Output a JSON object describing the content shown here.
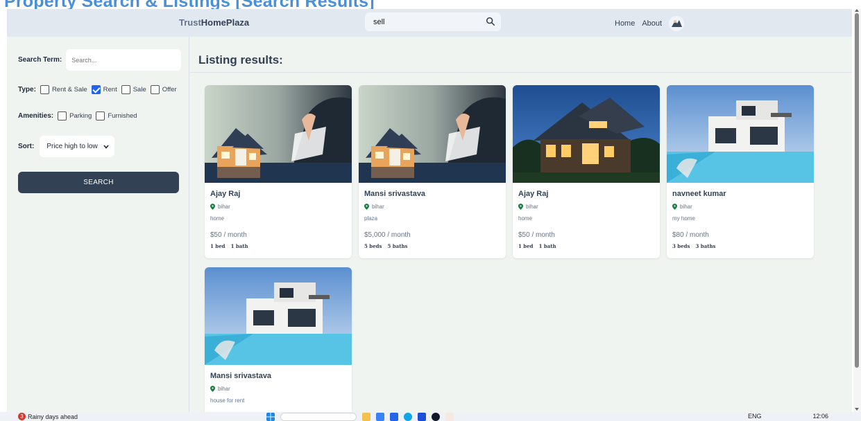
{
  "caption": "Property Search & Listings [Search Results]",
  "header": {
    "logo_light": "Trust",
    "logo_bold": "HomePlaza",
    "search_value": "sell",
    "nav": [
      "Home",
      "About"
    ]
  },
  "sidebar": {
    "search_term_label": "Search Term:",
    "search_placeholder": "Search...",
    "type_label": "Type:",
    "type_options": [
      {
        "label": "Rent & Sale",
        "checked": false
      },
      {
        "label": "Rent",
        "checked": true
      },
      {
        "label": "Sale",
        "checked": false
      },
      {
        "label": "Offer",
        "checked": false
      }
    ],
    "amenities_label": "Amenities:",
    "amenity_options": [
      {
        "label": "Parking",
        "checked": false
      },
      {
        "label": "Furnished",
        "checked": false
      }
    ],
    "sort_label": "Sort:",
    "sort_value": "Price high to low",
    "search_button": "SEARCH"
  },
  "main": {
    "title": "Listing results:",
    "listings": [
      {
        "name": "Ajay Raj",
        "location": "bihar",
        "description": "home",
        "price": "$50 / month",
        "beds": "1 bed",
        "baths": "1 bath",
        "image": "house-with-document"
      },
      {
        "name": "Mansi srivastava",
        "location": "bihar",
        "description": "plaza",
        "price": "$5,000 / month",
        "beds": "5 beds",
        "baths": "5 baths",
        "image": "house-with-document"
      },
      {
        "name": "Ajay Raj",
        "location": "bihar",
        "description": "home",
        "price": "$50 / month",
        "beds": "1 bed",
        "baths": "1 bath",
        "image": "night-house"
      },
      {
        "name": "navneet kumar",
        "location": "bihar",
        "description": "my home",
        "price": "$80 / month",
        "beds": "3 beds",
        "baths": "3 baths",
        "image": "pool-villa"
      },
      {
        "name": "Mansi srivastava",
        "location": "bihar",
        "description": "house for rent",
        "price": "",
        "beds": "",
        "baths": "",
        "image": "pool-villa"
      }
    ]
  },
  "taskbar": {
    "weather_badge": "3",
    "weather_text": "Rainy days ahead",
    "lang": "ENG",
    "time": "12:06"
  },
  "colors": {
    "header_bg": "#e2e8f0",
    "app_bg": "#f0f4f0",
    "button_bg": "#334155",
    "checkbox_accent": "#2563eb",
    "pin_green": "#15803d"
  }
}
